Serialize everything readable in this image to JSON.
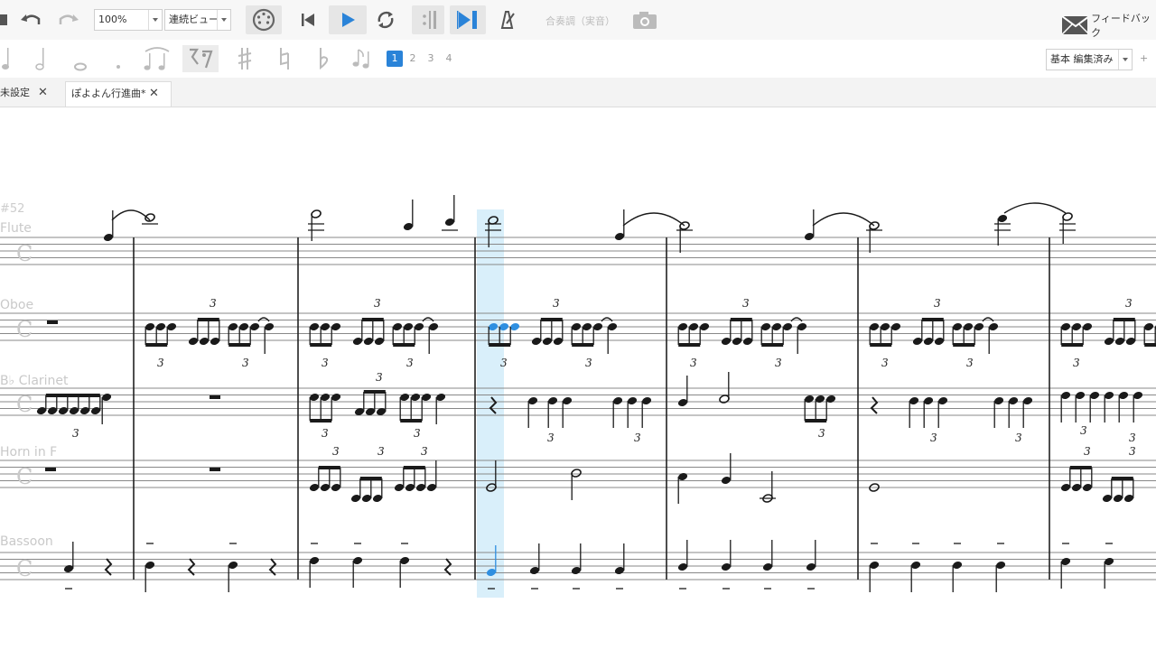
{
  "toolbar": {
    "zoom": "100%",
    "view_mode": "連続ビュー",
    "concert_pitch": "合奏調（実音）",
    "feedback": "フィードバック"
  },
  "palette": {
    "voices": [
      "1",
      "2",
      "3",
      "4"
    ],
    "active_voice": "1",
    "workspace": "基本 編集済み",
    "add": "+"
  },
  "tabs": [
    {
      "label": "未設定"
    },
    {
      "label": "ぽよよん行進曲*"
    }
  ],
  "score": {
    "measure_number": "#52",
    "instruments": [
      "Flute",
      "Oboe",
      "B♭ Clarinet",
      "Horn in F",
      "Bassoon"
    ],
    "tuplet_mark": "3"
  },
  "colors": {
    "accent": "#2a83d8",
    "playback_cursor": "#d7eefa",
    "selected_note": "#2f8fe0"
  }
}
